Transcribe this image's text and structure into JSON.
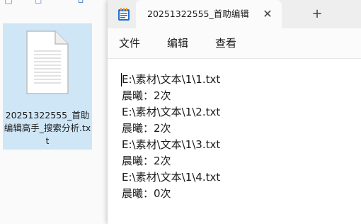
{
  "explorer": {
    "file": {
      "name": "20251322555_首助编辑高手_搜索分析.txt",
      "icon": "text-file-icon"
    },
    "toolbar_icons": [
      "view-icon",
      "share-icon"
    ]
  },
  "notepad": {
    "app_icon": "notepad-icon",
    "tab": {
      "title": "20251322555_首助编辑",
      "close_label": "✕"
    },
    "new_tab_label": "+",
    "menu": {
      "file": "文件",
      "edit": "编辑",
      "view": "查看"
    },
    "content": {
      "lines": [
        "E:\\素材\\文本\\1\\1.txt",
        "晨曦：2次",
        "E:\\素材\\文本\\1\\2.txt",
        "晨曦：2次",
        "E:\\素材\\文本\\1\\3.txt",
        "晨曦：2次",
        "E:\\素材\\文本\\1\\4.txt",
        "晨曦：0次"
      ]
    }
  },
  "colors": {
    "selection": "#cfe6f6",
    "tabbar": "#eeeeee",
    "accent": "#1f6fd1"
  }
}
